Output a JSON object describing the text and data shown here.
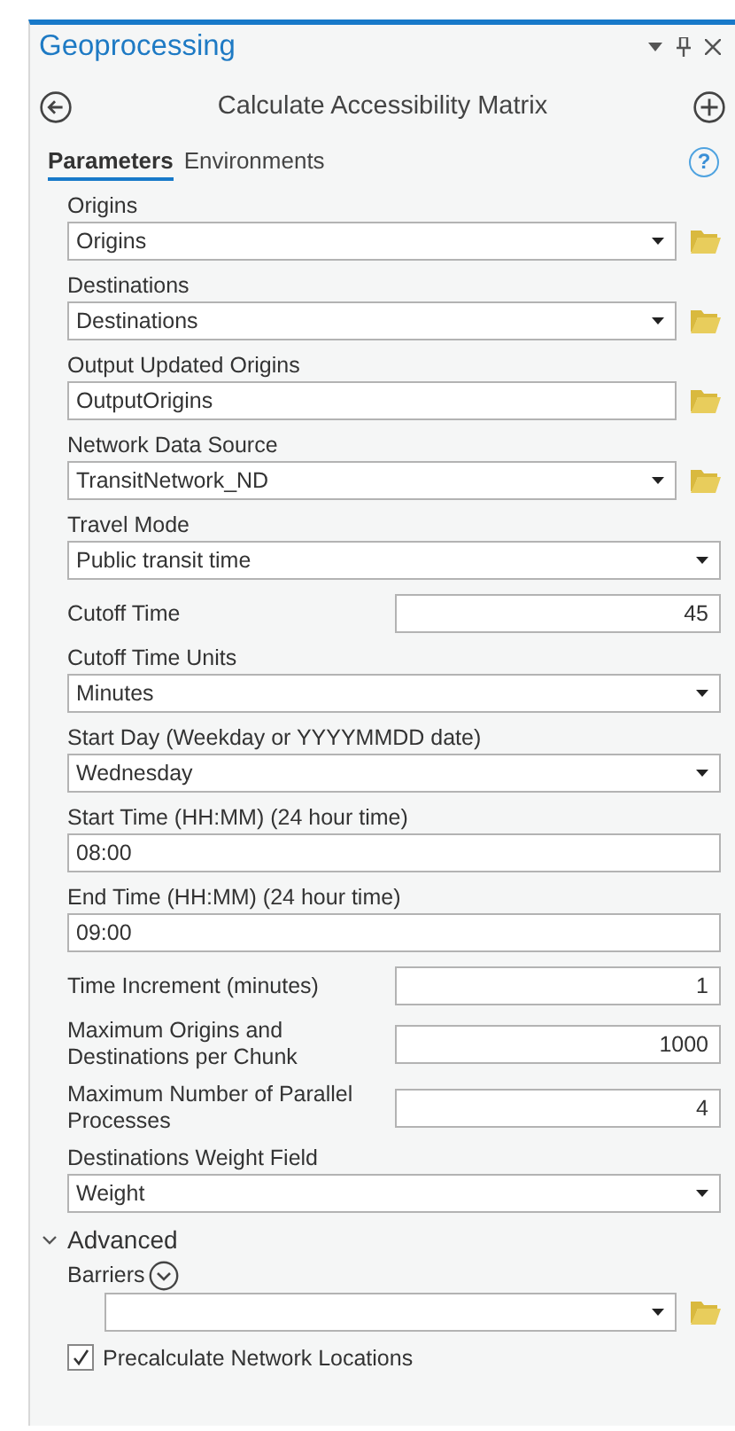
{
  "panel": {
    "title": "Geoprocessing"
  },
  "tool": {
    "title": "Calculate Accessibility Matrix"
  },
  "tabs": [
    {
      "label": "Parameters",
      "selected": true
    },
    {
      "label": "Environments",
      "selected": false
    }
  ],
  "help": "?",
  "parameters": [
    {
      "kind": "stacked",
      "label": "Origins",
      "field": {
        "kind": "dropdown",
        "value": "Origins"
      },
      "browse": true
    },
    {
      "kind": "stacked",
      "label": "Destinations",
      "field": {
        "kind": "dropdown",
        "value": "Destinations"
      },
      "browse": true
    },
    {
      "kind": "stacked",
      "label": "Output Updated Origins",
      "field": {
        "kind": "text",
        "value": "OutputOrigins"
      },
      "browse": true
    },
    {
      "kind": "stacked",
      "label": "Network Data Source",
      "field": {
        "kind": "dropdown",
        "value": "TransitNetwork_ND"
      },
      "browse": true
    },
    {
      "kind": "stacked",
      "label": "Travel Mode",
      "field": {
        "kind": "dropdown",
        "value": "Public transit time"
      },
      "browse": false
    },
    {
      "kind": "inline",
      "label": "Cutoff Time",
      "field": {
        "kind": "number",
        "value": "45"
      },
      "browse": false
    },
    {
      "kind": "stacked",
      "label": "Cutoff Time Units",
      "field": {
        "kind": "dropdown",
        "value": "Minutes"
      },
      "browse": false
    },
    {
      "kind": "stacked",
      "label": "Start Day (Weekday or YYYYMMDD date)",
      "field": {
        "kind": "dropdown",
        "value": "Wednesday"
      },
      "browse": false
    },
    {
      "kind": "stacked",
      "label": "Start Time (HH:MM) (24 hour time)",
      "field": {
        "kind": "text",
        "value": "08:00"
      },
      "browse": false
    },
    {
      "kind": "stacked",
      "label": "End Time (HH:MM) (24 hour time)",
      "field": {
        "kind": "text",
        "value": "09:00"
      },
      "browse": false
    },
    {
      "kind": "inline",
      "label": "Time Increment (minutes)",
      "field": {
        "kind": "number",
        "value": "1"
      },
      "browse": false
    },
    {
      "kind": "inline",
      "label": "Maximum Origins and Destinations per Chunk",
      "field": {
        "kind": "number",
        "value": "1000"
      },
      "browse": false
    },
    {
      "kind": "inline",
      "label": "Maximum Number of Parallel Processes",
      "field": {
        "kind": "number",
        "value": "4"
      },
      "browse": false
    },
    {
      "kind": "stacked",
      "label": "Destinations Weight Field",
      "field": {
        "kind": "dropdown",
        "value": "Weight"
      },
      "browse": false
    }
  ],
  "advanced": {
    "label": "Advanced",
    "expanded": true,
    "parameters": [
      {
        "kind": "multivalue",
        "label": "Barriers",
        "field": {
          "kind": "dropdown"
        },
        "browse": true
      },
      {
        "kind": "checkbox",
        "label": "Precalculate Network Locations",
        "checked": true
      }
    ]
  }
}
